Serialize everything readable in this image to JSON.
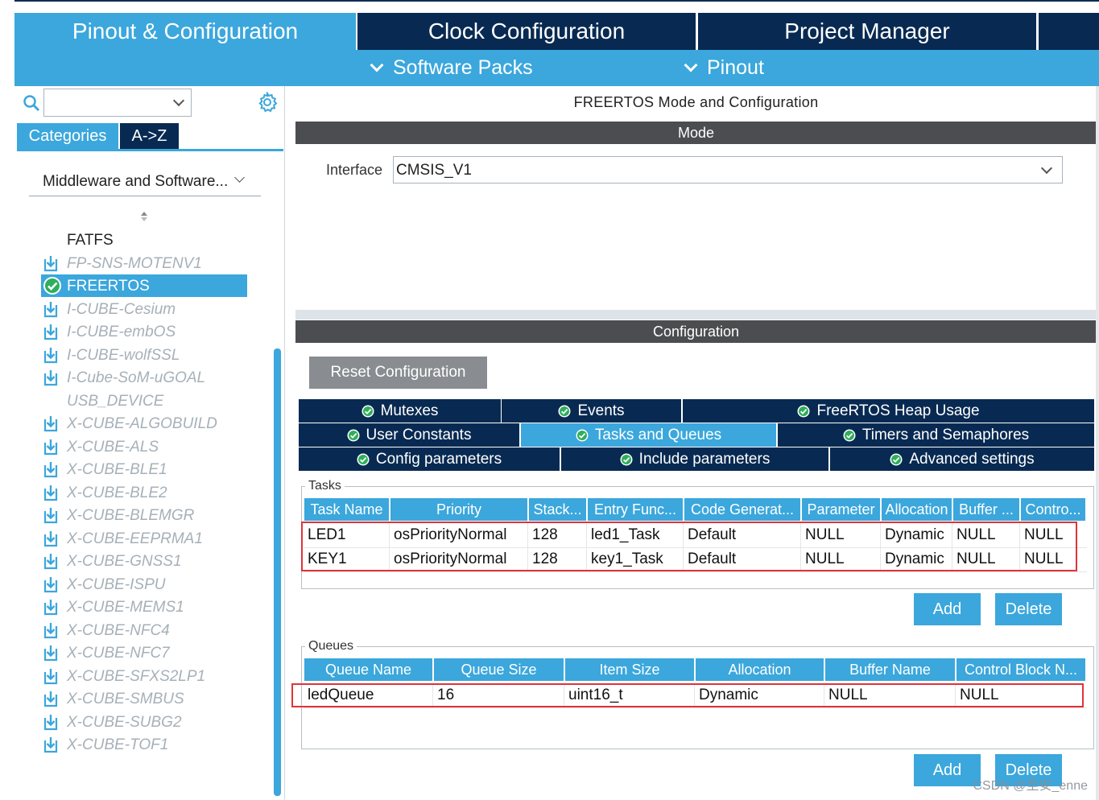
{
  "top_tabs": {
    "pinout": "Pinout & Configuration",
    "clock": "Clock Configuration",
    "project": "Project Manager"
  },
  "sub_menu": {
    "software_packs": "Software Packs",
    "pinout": "Pinout"
  },
  "left": {
    "search_value": "",
    "tab_categories": "Categories",
    "tab_az": "A->Z",
    "category": "Middleware and Software...",
    "items": [
      {
        "label": "FATFS",
        "state": "plain"
      },
      {
        "label": "FP-SNS-MOTENV1",
        "state": "disabled"
      },
      {
        "label": "FREERTOS",
        "state": "selected"
      },
      {
        "label": "I-CUBE-Cesium",
        "state": "disabled"
      },
      {
        "label": "I-CUBE-embOS",
        "state": "disabled"
      },
      {
        "label": "I-CUBE-wolfSSL",
        "state": "disabled"
      },
      {
        "label": "I-Cube-SoM-uGOAL",
        "state": "disabled"
      },
      {
        "label": "USB_DEVICE",
        "state": "disabled-noicon"
      },
      {
        "label": "X-CUBE-ALGOBUILD",
        "state": "disabled"
      },
      {
        "label": "X-CUBE-ALS",
        "state": "disabled"
      },
      {
        "label": "X-CUBE-BLE1",
        "state": "disabled"
      },
      {
        "label": "X-CUBE-BLE2",
        "state": "disabled"
      },
      {
        "label": "X-CUBE-BLEMGR",
        "state": "disabled"
      },
      {
        "label": "X-CUBE-EEPRMA1",
        "state": "disabled"
      },
      {
        "label": "X-CUBE-GNSS1",
        "state": "disabled"
      },
      {
        "label": "X-CUBE-ISPU",
        "state": "disabled"
      },
      {
        "label": "X-CUBE-MEMS1",
        "state": "disabled"
      },
      {
        "label": "X-CUBE-NFC4",
        "state": "disabled"
      },
      {
        "label": "X-CUBE-NFC7",
        "state": "disabled"
      },
      {
        "label": "X-CUBE-SFXS2LP1",
        "state": "disabled"
      },
      {
        "label": "X-CUBE-SMBUS",
        "state": "disabled"
      },
      {
        "label": "X-CUBE-SUBG2",
        "state": "disabled"
      },
      {
        "label": "X-CUBE-TOF1",
        "state": "disabled"
      }
    ]
  },
  "mode": {
    "title": "FREERTOS Mode and Configuration",
    "header": "Mode",
    "interface_label": "Interface",
    "interface_value": "CMSIS_V1"
  },
  "config": {
    "header": "Configuration",
    "reset_label": "Reset Configuration",
    "tabs_row1": [
      "Mutexes",
      "Events",
      "FreeRTOS Heap Usage"
    ],
    "tabs_row2": [
      "User Constants",
      "Tasks and Queues",
      "Timers and Semaphores"
    ],
    "tabs_row3": [
      "Config parameters",
      "Include parameters",
      "Advanced settings"
    ],
    "active_tab": "Tasks and Queues"
  },
  "tasks": {
    "label": "Tasks",
    "columns": [
      "Task Name",
      "Priority",
      "Stack...",
      "Entry Func...",
      "Code Generat...",
      "Parameter",
      "Allocation",
      "Buffer ...",
      "Contro..."
    ],
    "rows": [
      [
        "LED1",
        "osPriorityNormal",
        "128",
        "led1_Task",
        "Default",
        "NULL",
        "Dynamic",
        "NULL",
        "NULL"
      ],
      [
        "KEY1",
        "osPriorityNormal",
        "128",
        "key1_Task",
        "Default",
        "NULL",
        "Dynamic",
        "NULL",
        "NULL"
      ]
    ],
    "add_label": "Add",
    "delete_label": "Delete"
  },
  "queues": {
    "label": "Queues",
    "columns": [
      "Queue Name",
      "Queue Size",
      "Item Size",
      "Allocation",
      "Buffer Name",
      "Control Block N..."
    ],
    "rows": [
      [
        "ledQueue",
        "16",
        "uint16_t",
        "Dynamic",
        "NULL",
        "NULL"
      ]
    ],
    "add_label": "Add",
    "delete_label": "Delete"
  },
  "watermark": "CSDN @至安_enne",
  "colors": {
    "accent": "#3ba7dc",
    "dark_navy": "#082a52",
    "header_gray": "#4b4d50",
    "highlight_red": "#e0333a",
    "ok_green": "#2fae5c"
  }
}
